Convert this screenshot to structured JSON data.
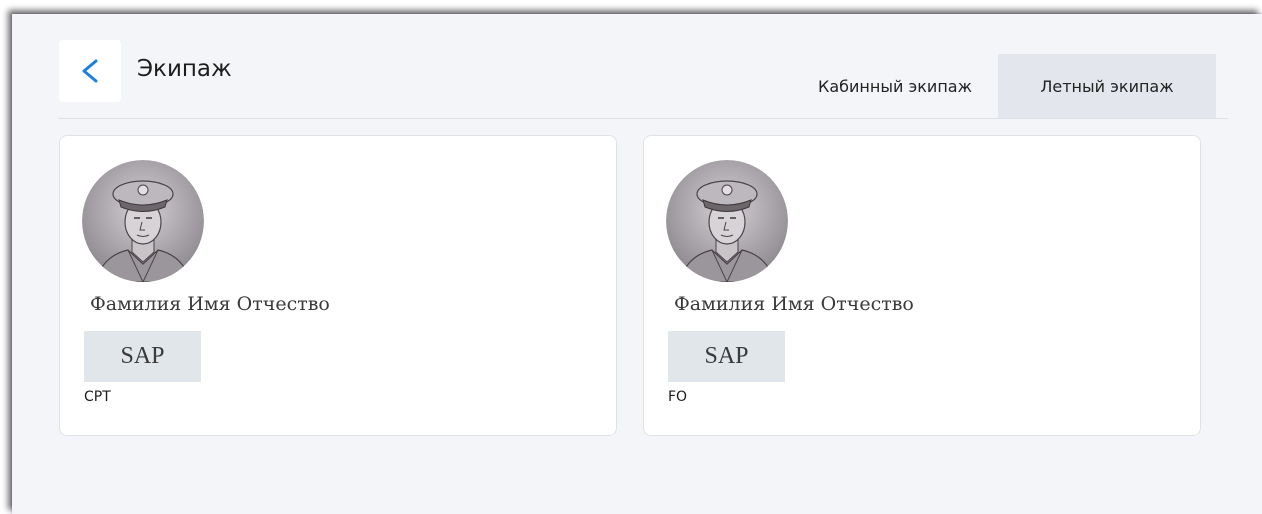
{
  "header": {
    "back_icon": "chevron-left-icon",
    "title": "Экипаж"
  },
  "tabs": [
    {
      "label": "Кабинный экипаж",
      "active": false
    },
    {
      "label": "Летный экипаж",
      "active": true
    }
  ],
  "colors": {
    "accent": "#1a7fe3",
    "active_tab_bg": "#e3e7ed",
    "badge_bg": "#e1e6eb",
    "page_bg": "#f3f5f8"
  },
  "crew": [
    {
      "avatar_icon": "pilot-avatar-icon",
      "name": "Фамилия Имя Отчество",
      "badge": "SAP",
      "role": "CPT"
    },
    {
      "avatar_icon": "pilot-avatar-icon",
      "name": "Фамилия Имя Отчество",
      "badge": "SAP",
      "role": "FO"
    }
  ]
}
